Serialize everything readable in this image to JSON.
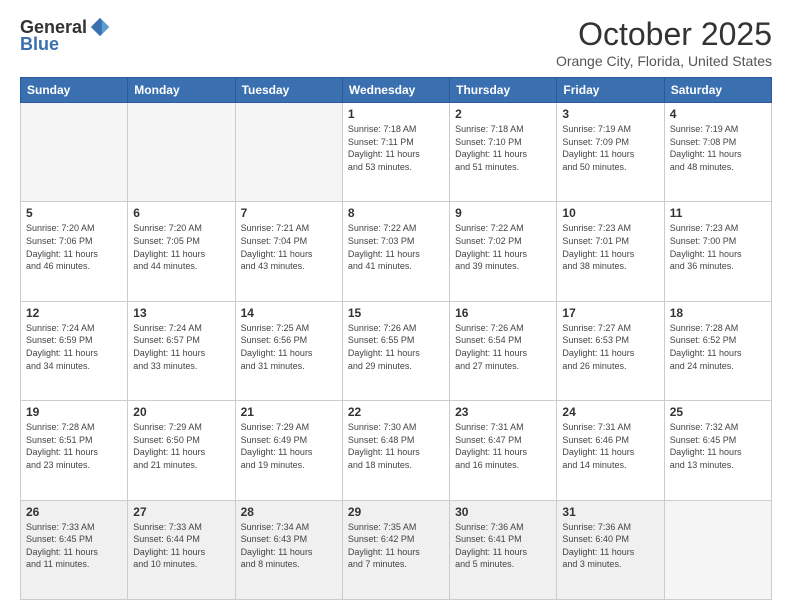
{
  "logo": {
    "general": "General",
    "blue": "Blue"
  },
  "header": {
    "month": "October 2025",
    "location": "Orange City, Florida, United States"
  },
  "weekdays": [
    "Sunday",
    "Monday",
    "Tuesday",
    "Wednesday",
    "Thursday",
    "Friday",
    "Saturday"
  ],
  "weeks": [
    [
      {
        "day": "",
        "info": ""
      },
      {
        "day": "",
        "info": ""
      },
      {
        "day": "",
        "info": ""
      },
      {
        "day": "1",
        "info": "Sunrise: 7:18 AM\nSunset: 7:11 PM\nDaylight: 11 hours\nand 53 minutes."
      },
      {
        "day": "2",
        "info": "Sunrise: 7:18 AM\nSunset: 7:10 PM\nDaylight: 11 hours\nand 51 minutes."
      },
      {
        "day": "3",
        "info": "Sunrise: 7:19 AM\nSunset: 7:09 PM\nDaylight: 11 hours\nand 50 minutes."
      },
      {
        "day": "4",
        "info": "Sunrise: 7:19 AM\nSunset: 7:08 PM\nDaylight: 11 hours\nand 48 minutes."
      }
    ],
    [
      {
        "day": "5",
        "info": "Sunrise: 7:20 AM\nSunset: 7:06 PM\nDaylight: 11 hours\nand 46 minutes."
      },
      {
        "day": "6",
        "info": "Sunrise: 7:20 AM\nSunset: 7:05 PM\nDaylight: 11 hours\nand 44 minutes."
      },
      {
        "day": "7",
        "info": "Sunrise: 7:21 AM\nSunset: 7:04 PM\nDaylight: 11 hours\nand 43 minutes."
      },
      {
        "day": "8",
        "info": "Sunrise: 7:22 AM\nSunset: 7:03 PM\nDaylight: 11 hours\nand 41 minutes."
      },
      {
        "day": "9",
        "info": "Sunrise: 7:22 AM\nSunset: 7:02 PM\nDaylight: 11 hours\nand 39 minutes."
      },
      {
        "day": "10",
        "info": "Sunrise: 7:23 AM\nSunset: 7:01 PM\nDaylight: 11 hours\nand 38 minutes."
      },
      {
        "day": "11",
        "info": "Sunrise: 7:23 AM\nSunset: 7:00 PM\nDaylight: 11 hours\nand 36 minutes."
      }
    ],
    [
      {
        "day": "12",
        "info": "Sunrise: 7:24 AM\nSunset: 6:59 PM\nDaylight: 11 hours\nand 34 minutes."
      },
      {
        "day": "13",
        "info": "Sunrise: 7:24 AM\nSunset: 6:57 PM\nDaylight: 11 hours\nand 33 minutes."
      },
      {
        "day": "14",
        "info": "Sunrise: 7:25 AM\nSunset: 6:56 PM\nDaylight: 11 hours\nand 31 minutes."
      },
      {
        "day": "15",
        "info": "Sunrise: 7:26 AM\nSunset: 6:55 PM\nDaylight: 11 hours\nand 29 minutes."
      },
      {
        "day": "16",
        "info": "Sunrise: 7:26 AM\nSunset: 6:54 PM\nDaylight: 11 hours\nand 27 minutes."
      },
      {
        "day": "17",
        "info": "Sunrise: 7:27 AM\nSunset: 6:53 PM\nDaylight: 11 hours\nand 26 minutes."
      },
      {
        "day": "18",
        "info": "Sunrise: 7:28 AM\nSunset: 6:52 PM\nDaylight: 11 hours\nand 24 minutes."
      }
    ],
    [
      {
        "day": "19",
        "info": "Sunrise: 7:28 AM\nSunset: 6:51 PM\nDaylight: 11 hours\nand 23 minutes."
      },
      {
        "day": "20",
        "info": "Sunrise: 7:29 AM\nSunset: 6:50 PM\nDaylight: 11 hours\nand 21 minutes."
      },
      {
        "day": "21",
        "info": "Sunrise: 7:29 AM\nSunset: 6:49 PM\nDaylight: 11 hours\nand 19 minutes."
      },
      {
        "day": "22",
        "info": "Sunrise: 7:30 AM\nSunset: 6:48 PM\nDaylight: 11 hours\nand 18 minutes."
      },
      {
        "day": "23",
        "info": "Sunrise: 7:31 AM\nSunset: 6:47 PM\nDaylight: 11 hours\nand 16 minutes."
      },
      {
        "day": "24",
        "info": "Sunrise: 7:31 AM\nSunset: 6:46 PM\nDaylight: 11 hours\nand 14 minutes."
      },
      {
        "day": "25",
        "info": "Sunrise: 7:32 AM\nSunset: 6:45 PM\nDaylight: 11 hours\nand 13 minutes."
      }
    ],
    [
      {
        "day": "26",
        "info": "Sunrise: 7:33 AM\nSunset: 6:45 PM\nDaylight: 11 hours\nand 11 minutes."
      },
      {
        "day": "27",
        "info": "Sunrise: 7:33 AM\nSunset: 6:44 PM\nDaylight: 11 hours\nand 10 minutes."
      },
      {
        "day": "28",
        "info": "Sunrise: 7:34 AM\nSunset: 6:43 PM\nDaylight: 11 hours\nand 8 minutes."
      },
      {
        "day": "29",
        "info": "Sunrise: 7:35 AM\nSunset: 6:42 PM\nDaylight: 11 hours\nand 7 minutes."
      },
      {
        "day": "30",
        "info": "Sunrise: 7:36 AM\nSunset: 6:41 PM\nDaylight: 11 hours\nand 5 minutes."
      },
      {
        "day": "31",
        "info": "Sunrise: 7:36 AM\nSunset: 6:40 PM\nDaylight: 11 hours\nand 3 minutes."
      },
      {
        "day": "",
        "info": ""
      }
    ]
  ]
}
